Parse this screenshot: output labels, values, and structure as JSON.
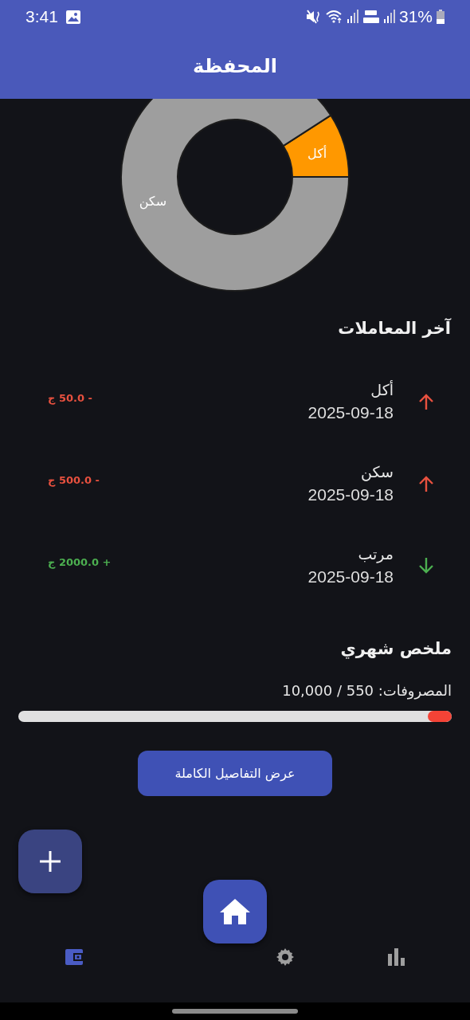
{
  "status_bar": {
    "time": "3:41",
    "battery": "31%"
  },
  "app_bar": {
    "title": "المحفظة"
  },
  "chart": {
    "chart_data": {
      "type": "donut",
      "categories": [
        "أكل",
        "سكن"
      ],
      "values": [
        9.09,
        90.91
      ]
    }
  },
  "recent": {
    "title": "آخر المعاملات",
    "transactions": [
      {
        "kind": "expense",
        "name": "أكل",
        "date": "2025-09-18",
        "amount": "- 50.0 ج"
      },
      {
        "kind": "expense",
        "name": "سكن",
        "date": "2025-09-18",
        "amount": "- 500.0 ج"
      },
      {
        "kind": "income",
        "name": "مرتب",
        "date": "2025-09-18",
        "amount": "+ 2000.0 ج"
      }
    ]
  },
  "summary": {
    "title": "ملخص شهري",
    "expenses_label": "المصروفات: 550 / 10,000",
    "level": 0.055,
    "button": "عرض التفاصيل الكاملة"
  },
  "nav": {
    "items": [
      {
        "kind": "wallet",
        "selected": true
      },
      {
        "kind": "settings",
        "selected": false
      },
      {
        "kind": "stats",
        "selected": false
      }
    ]
  }
}
